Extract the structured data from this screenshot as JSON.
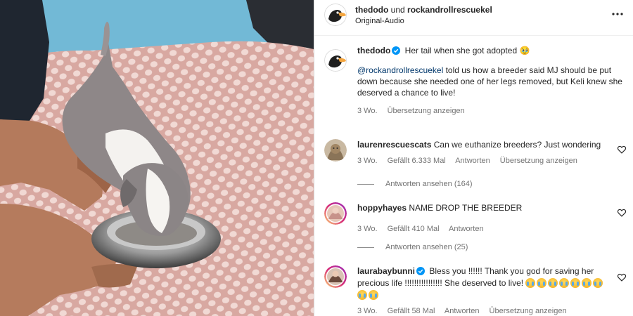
{
  "header": {
    "account": "thedodo",
    "joiner": "und",
    "coauthor": "rockandrollrescuekel",
    "audio": "Original-Audio"
  },
  "caption": {
    "username": "thedodo",
    "text": "Her tail when she got adopted 🥹",
    "mention": "@rockandrollrescuekel",
    "body": "told us how a breeder said MJ should be put down because she needed one of her legs removed, but Keli knew she deserved a chance to live!",
    "time": "3 Wo.",
    "translate": "Übersetzung anzeigen"
  },
  "comments": [
    {
      "username": "laurenrescuescats",
      "text": "Can we euthanize breeders? Just wondering",
      "time": "3 Wo.",
      "likes": "Gefällt 6.333 Mal",
      "reply": "Antworten",
      "translate": "Übersetzung anzeigen",
      "view_replies": "Antworten ansehen (164)"
    },
    {
      "username": "hoppyhayes",
      "text": "NAME DROP THE BREEDER",
      "time": "3 Wo.",
      "likes": "Gefällt 410 Mal",
      "reply": "Antworten",
      "view_replies": "Antworten ansehen (25)"
    },
    {
      "username": "laurabaybunni",
      "text": "Bless you !!!!!! Thank you god for saving her precious life !!!!!!!!!!!!!!!! She deserved to live!",
      "time": "3 Wo.",
      "likes": "Gefällt 58 Mal",
      "reply": "Antworten",
      "translate": "Übersetzung anzeigen"
    }
  ],
  "icons": {
    "more": "more-horizontal-icon",
    "verified": "verified-badge-icon",
    "like": "heart-icon",
    "emoji": "crying-face-emoji"
  },
  "colors": {
    "verified": "#0095f6",
    "mention": "#00376b",
    "meta": "#737373"
  }
}
